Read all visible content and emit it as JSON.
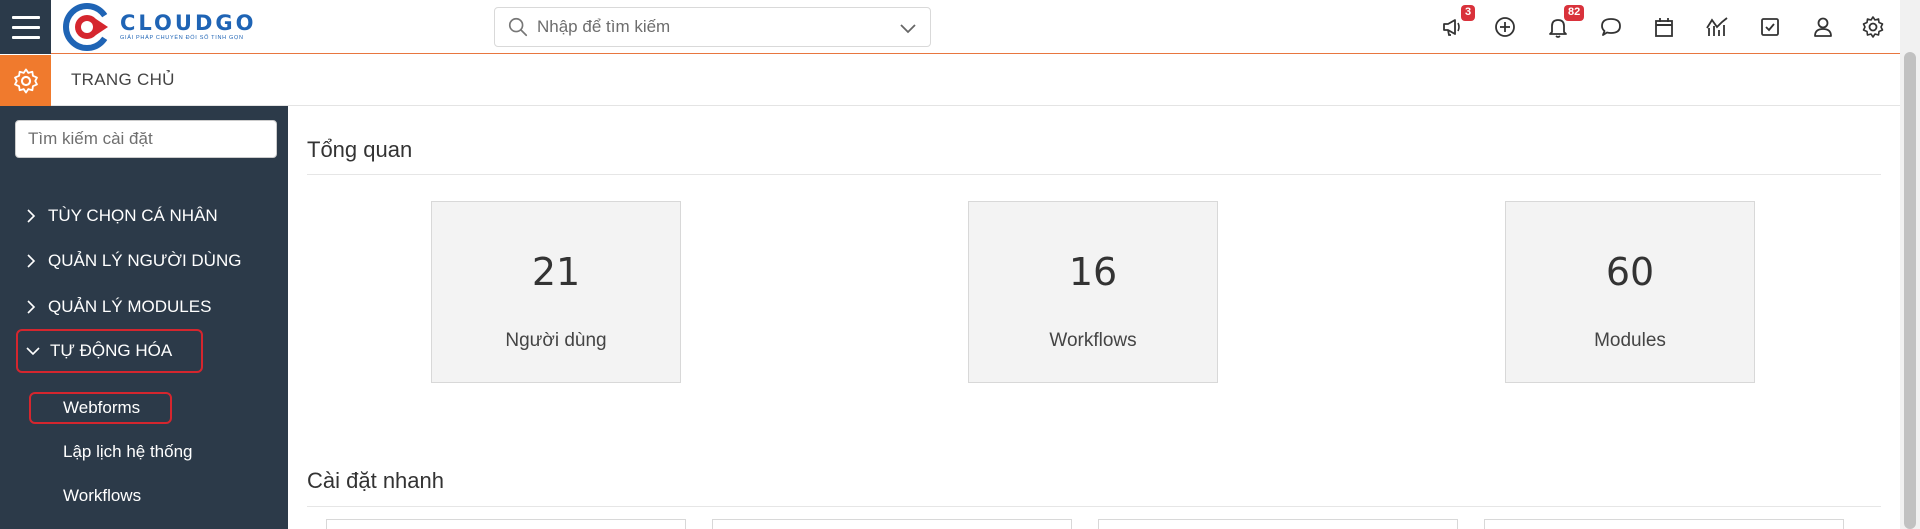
{
  "brand": {
    "name": "CLOUDGO",
    "tagline": "GIẢI PHÁP CHUYỂN ĐỔI SỐ TINH GỌN",
    "primary_color": "#1f64b5",
    "accent_color": "#d5262e"
  },
  "header": {
    "search_placeholder": "Nhập để tìm kiếm",
    "icons": [
      {
        "name": "megaphone-icon",
        "badge": "3"
      },
      {
        "name": "add-circle-icon",
        "badge": ""
      },
      {
        "name": "bell-icon",
        "badge": "82"
      },
      {
        "name": "chat-icon",
        "badge": ""
      },
      {
        "name": "calendar-icon",
        "badge": ""
      },
      {
        "name": "chart-icon",
        "badge": ""
      },
      {
        "name": "task-icon",
        "badge": ""
      },
      {
        "name": "user-icon",
        "badge": ""
      },
      {
        "name": "settings-icon",
        "badge": ""
      }
    ]
  },
  "subheader": {
    "title": "TRANG CHỦ"
  },
  "sidebar": {
    "search_placeholder": "Tìm kiếm cài đặt",
    "items": [
      {
        "label": "TÙY CHỌN CÁ NHÂN",
        "expanded": false
      },
      {
        "label": "QUẢN LÝ NGƯỜI DÙNG",
        "expanded": false
      },
      {
        "label": "QUẢN LÝ MODULES",
        "expanded": false
      },
      {
        "label": "TỰ ĐỘNG HÓA",
        "expanded": true,
        "children": [
          {
            "label": "Webforms",
            "selected": true
          },
          {
            "label": "Lập lịch hệ thống",
            "selected": false
          },
          {
            "label": "Workflows",
            "selected": false
          }
        ]
      }
    ]
  },
  "main": {
    "overview_title": "Tổng quan",
    "stats": [
      {
        "value": "21",
        "label": "Người dùng"
      },
      {
        "value": "16",
        "label": "Workflows"
      },
      {
        "value": "60",
        "label": "Modules"
      }
    ],
    "quick_settings_title": "Cài đặt nhanh"
  }
}
